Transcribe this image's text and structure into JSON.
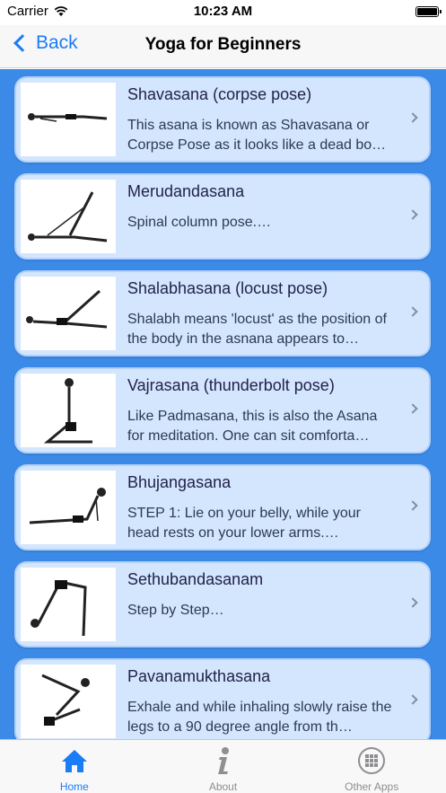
{
  "status_bar": {
    "carrier": "Carrier",
    "time": "10:23 AM"
  },
  "nav": {
    "back_label": "Back",
    "title": "Yoga for Beginners"
  },
  "poses": [
    {
      "title": "Shavasana (corpse pose)",
      "desc": "This asana is known as Shavasana or Corpse Pose as it looks like a dead bo…"
    },
    {
      "title": "Merudandasana",
      "desc": "Spinal column pose.…"
    },
    {
      "title": "Shalabhasana (locust pose)",
      "desc": "Shalabh means 'locust' as the position of the body in the asnana appears to…"
    },
    {
      "title": "Vajrasana (thunderbolt pose)",
      "desc": "Like Padmasana, this is also the Asana for meditation. One can sit comforta…"
    },
    {
      "title": "Bhujangasana",
      "desc": "STEP 1: Lie on your belly, while your head rests on your lower arms.…"
    },
    {
      "title": "Sethubandasanam",
      "desc": "Step by Step…"
    },
    {
      "title": "Pavanamukthasana",
      "desc": "Exhale and while inhaling slowly raise the legs to a 90 degree angle from th…"
    }
  ],
  "tabs": [
    {
      "label": "Home",
      "icon": "home-icon",
      "active": true
    },
    {
      "label": "About",
      "icon": "info-icon",
      "active": false
    },
    {
      "label": "Other Apps",
      "icon": "grid-icon",
      "active": false
    }
  ],
  "colors": {
    "accent": "#1a7cf6",
    "list_bg": "#3b8ae8",
    "card_bg": "#d3e6fd"
  }
}
